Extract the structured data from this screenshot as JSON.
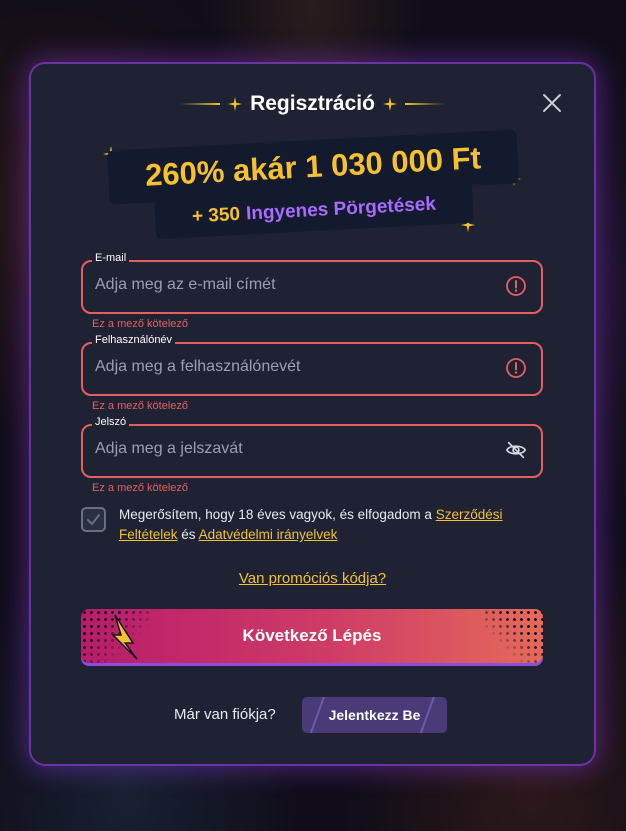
{
  "modal": {
    "title": "Regisztráció",
    "close_icon": "close-icon",
    "promo_line1": "260% akár 1 030 000 Ft",
    "promo_line2_prefix": "+ 350",
    "promo_line2_suffix": "Ingyenes Pörgetések"
  },
  "fields": {
    "email": {
      "label": "E-mail",
      "placeholder": "Adja meg az e-mail címét",
      "value": "",
      "error": "Ez a mező kötelező",
      "icon": "error-icon"
    },
    "username": {
      "label": "Felhasználónév",
      "placeholder": "Adja meg a felhasználónevét",
      "value": "",
      "error": "Ez a mező kötelező",
      "icon": "error-icon"
    },
    "password": {
      "label": "Jelszó",
      "placeholder": "Adja meg a jelszavát",
      "value": "",
      "error": "Ez a mező kötelező",
      "icon": "eye-off-icon"
    }
  },
  "terms": {
    "text_before": "Megerősítem, hogy 18 éves vagyok, és elfogadom a",
    "link_terms": "Szerződési Feltételek",
    "text_mid": "és",
    "link_privacy": "Adatvédelmi irányelvek"
  },
  "promo_code_link": "Van promóciós kódja?",
  "next_button": "Következő Lépés",
  "have_account": "Már van fiókja?",
  "login_button": "Jelentkezz Be",
  "colors": {
    "accent_yellow": "#f2c230",
    "error_red": "#e46060",
    "purple": "#a86bff",
    "modal_bg": "#1e2233"
  }
}
